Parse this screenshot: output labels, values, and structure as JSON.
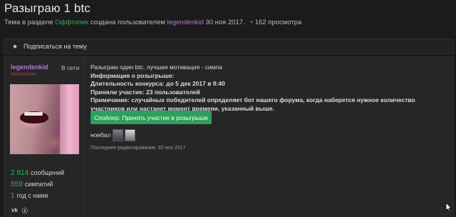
{
  "thread": {
    "title": "Разыграю 1 btc",
    "meta_prefix": "Тема в разделе",
    "section": "Оффтопик",
    "meta_middle": "создана пользователем",
    "author": "legendenkid",
    "date": "30 ноя 2017.",
    "views": "162 просмотра"
  },
  "subscribe": {
    "icon": "star-icon",
    "label": "Подписаться на тему"
  },
  "user": {
    "name": "legendenkid",
    "status": "В сети",
    "title": "skinecheet",
    "messages_count": "2 814",
    "messages_label": "сообщений",
    "likes_count": "559",
    "likes_label": "симпатий",
    "years_count": "1",
    "years_label": "год с нами",
    "socials": [
      "vk-icon",
      "skype-icon"
    ]
  },
  "post": {
    "intro": "Разыграю один btc. лучшая мотивация - симпа",
    "info_header": "Информация о розыгрыше:",
    "duration": "Длительность конкурса: до 5 дек 2017 в 9:40",
    "participants": "Приняли участие: 23 пользователей",
    "note": "Примечание: случайных победителей определяет бот нашего форума, когда наберется нужное количество участников или настанет момент времени, указанный выше.",
    "spoiler_button": "Спойлер: Принять участие в розыгрыше",
    "reaction_text": "ноебал",
    "last_edited": "Последнее редактирование: 30 ноя 2017"
  },
  "colors": {
    "background": "#1b1b1b",
    "panel": "#262626",
    "accent_green": "#2ea05a",
    "link_green": "#34b05a",
    "username_purple": "#b07ad6",
    "usertitle_red": "#c8343a"
  }
}
